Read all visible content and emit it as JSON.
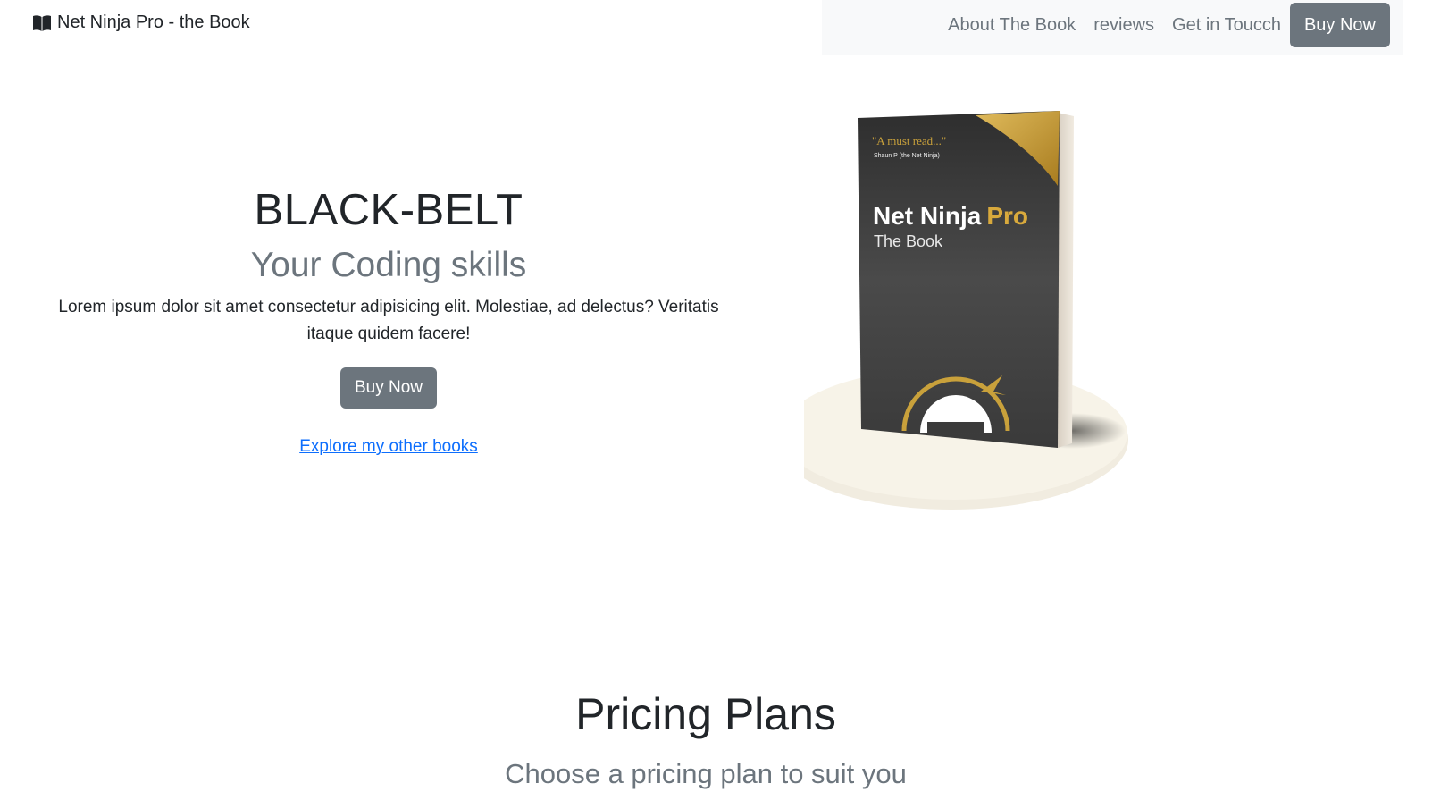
{
  "navbar": {
    "brand": "Net Ninja Pro - the Book",
    "brand_icon": "book-icon",
    "links": [
      {
        "label": "About The Book"
      },
      {
        "label": "reviews"
      },
      {
        "label": "Get in Toucch"
      }
    ],
    "buy_label": "Buy Now"
  },
  "hero": {
    "title": "BLACK-BELT",
    "subtitle": "Your Coding skills",
    "text": "Lorem ipsum dolor sit amet consectetur adipisicing elit. Molestiae, ad delectus? Veritatis itaque quidem facere!",
    "buy_label": "Buy Now",
    "link_text": "Explore my other books"
  },
  "book": {
    "quote": "\"A must read...\"",
    "quote_author": "Shaun P (the Net Ninja)",
    "title_main": "Net Ninja",
    "title_accent": "Pro",
    "title_sub": "The Book"
  },
  "pricing": {
    "title": "Pricing Plans",
    "subtitle": "Choose a pricing plan to suit you"
  },
  "colors": {
    "secondary": "#6c757d",
    "link": "#0d6efd",
    "book_gold": "#c9a13b",
    "book_dark": "#3b3b3b"
  }
}
